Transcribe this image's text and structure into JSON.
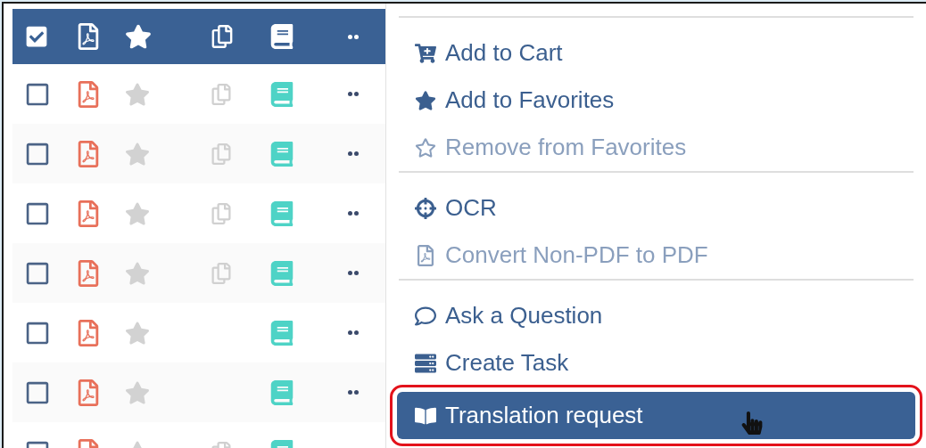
{
  "table": {
    "header": {
      "checked": true
    },
    "rows": [
      {
        "checked": false,
        "starred": false,
        "has_copy": true
      },
      {
        "checked": false,
        "starred": false,
        "has_copy": true
      },
      {
        "checked": false,
        "starred": false,
        "has_copy": true
      },
      {
        "checked": false,
        "starred": false,
        "has_copy": true
      },
      {
        "checked": false,
        "starred": false,
        "has_copy": false
      },
      {
        "checked": false,
        "starred": false,
        "has_copy": false
      },
      {
        "checked": false,
        "starred": false,
        "has_copy": true
      }
    ]
  },
  "context_menu": {
    "items": [
      {
        "kind": "separator"
      },
      {
        "kind": "item",
        "label": "Add to Cart",
        "disabled": false,
        "selected": false
      },
      {
        "kind": "item",
        "label": "Add to Favorites",
        "disabled": false,
        "selected": false
      },
      {
        "kind": "item",
        "label": "Remove from Favorites",
        "disabled": true,
        "selected": false
      },
      {
        "kind": "separator"
      },
      {
        "kind": "item",
        "label": "OCR",
        "disabled": false,
        "selected": false
      },
      {
        "kind": "item",
        "label": "Convert Non-PDF to PDF",
        "disabled": true,
        "selected": false
      },
      {
        "kind": "separator"
      },
      {
        "kind": "item",
        "label": "Ask a Question",
        "disabled": false,
        "selected": false
      },
      {
        "kind": "item",
        "label": "Create Task",
        "disabled": false,
        "selected": false
      },
      {
        "kind": "item",
        "label": "Translation request",
        "disabled": false,
        "selected": true
      }
    ]
  }
}
